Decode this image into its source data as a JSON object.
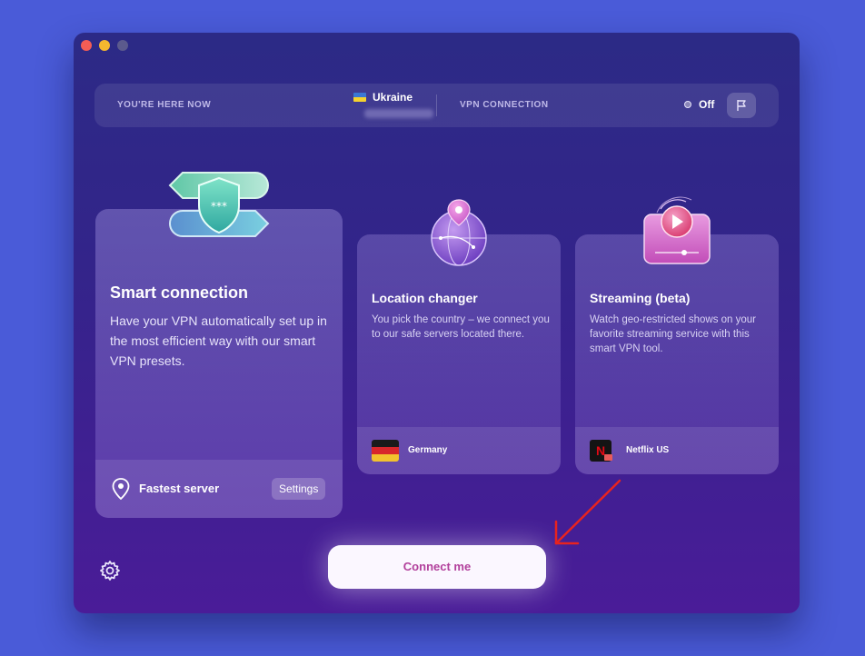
{
  "window": {
    "controls": [
      "close",
      "minimize",
      "zoom"
    ]
  },
  "topbar": {
    "here_label": "YOU'RE HERE NOW",
    "country": "Ukraine",
    "vpn_label": "VPN CONNECTION",
    "status": "Off"
  },
  "cards": {
    "smart": {
      "title": "Smart connection",
      "description": "Have your VPN automatically set up in the most efficient way with our smart VPN presets.",
      "footer_label": "Fastest server",
      "settings_label": "Settings"
    },
    "location": {
      "title": "Location changer",
      "description": "You pick the country – we connect you to our safe servers located there.",
      "footer_label": "Germany"
    },
    "streaming": {
      "title": "Streaming (beta)",
      "description": "Watch geo-restricted shows on your favorite streaming service with this smart VPN tool.",
      "footer_label": "Netflix US",
      "service_logo": "N"
    }
  },
  "connect_button": "Connect me",
  "colors": {
    "background": "#4a5bd8",
    "accent_text": "#b2409c",
    "annotation_arrow": "#e8231f"
  }
}
